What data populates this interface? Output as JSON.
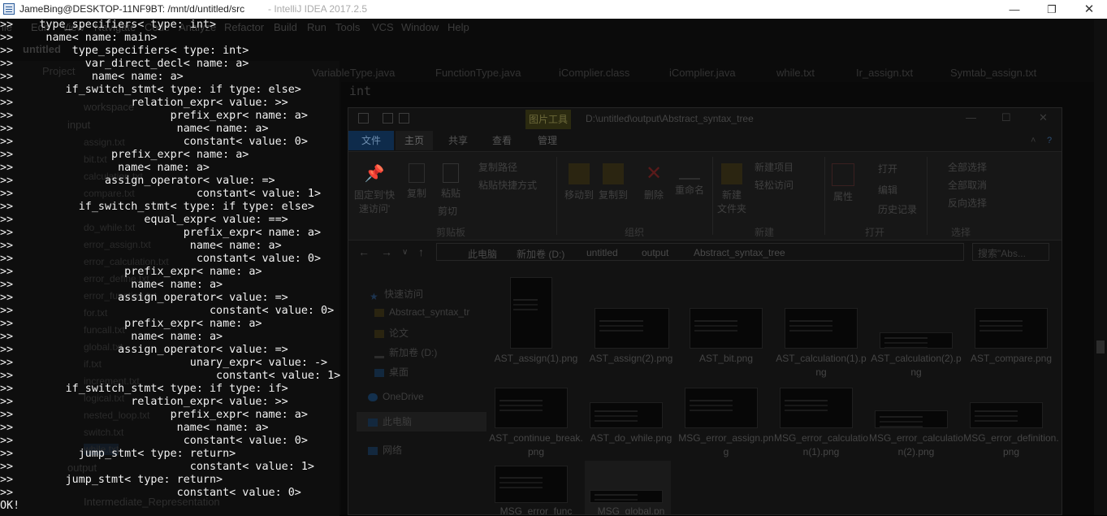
{
  "window": {
    "title": "JameBing@DESKTOP-11NF9BT: /mnt/d/untitled/src",
    "ghost_title": "- IntelliJ IDEA 2017.2.5",
    "controls": {
      "minimize": "—",
      "restore": "❐",
      "close": "✕"
    }
  },
  "ide": {
    "menus": [
      "ile",
      "Edit",
      "View",
      "Navigate",
      "Code",
      "Analyze",
      "Refactor",
      "Build",
      "Run",
      "Tools",
      "VCS",
      "Window",
      "Help"
    ],
    "project_title": "untitled",
    "project_label": "Project",
    "tabs": [
      "VariableType.java",
      "FunctionType.java",
      "iComplier.class",
      "iComplier.java",
      "while.txt",
      "Ir_assign.txt",
      "Symtab_assign.txt"
    ],
    "tree_folders": [
      "workspace",
      "input",
      "output",
      "Intermediate_Representation"
    ],
    "tree_files": [
      "assign.txt",
      "bit.txt",
      "calculation.txt",
      "compare.txt",
      "do_while.txt",
      "error_assign.txt",
      "error_calculation.txt",
      "error_define.txt",
      "error_function.txt",
      "for.txt",
      "funcall.txt",
      "global.txt",
      "if.txt",
      "increment.txt",
      "logical.txt",
      "nested_loop.txt",
      "switch.txt",
      "while.txt"
    ],
    "editor_first_line": "int"
  },
  "explorer": {
    "path_title": "D:\\untitled\\output\\Abstract_syntax_tree",
    "picture_tools": "图片工具",
    "tabs": [
      "文件",
      "主页",
      "共享",
      "查看",
      "管理"
    ],
    "ribbon": {
      "pin": "固定到'快\n速访问'",
      "copy": "复制",
      "paste": "粘贴",
      "copy_path": "复制路径",
      "paste_shortcut": "粘贴快捷方式",
      "cut": "剪切",
      "move_to": "移动到",
      "copy_to": "复制到",
      "delete": "删除",
      "rename": "重命名",
      "new_folder": "新建\n文件夹",
      "new_item": "新建项目",
      "easy_access": "轻松访问",
      "properties": "属性",
      "open": "打开",
      "edit": "编辑",
      "history": "历史记录",
      "select_all": "全部选择",
      "select_none": "全部取消",
      "invert_selection": "反向选择",
      "groups": {
        "clipboard": "剪贴板",
        "organize": "组织",
        "new": "新建",
        "open": "打开",
        "select": "选择"
      }
    },
    "address": [
      "此电脑",
      "新加卷 (D:)",
      "untitled",
      "output",
      "Abstract_syntax_tree"
    ],
    "search_placeholder": "搜索\"Abs...",
    "nav": {
      "quick_access": "快速访问",
      "ast_folder": "Abstract_syntax_tr",
      "paper": "论文",
      "drive": "新加卷 (D:)",
      "desktop": "桌面",
      "onedrive": "OneDrive",
      "this_pc": "此电脑",
      "network": "网络"
    },
    "files": [
      "AST_assign(1).png",
      "AST_assign(2).png",
      "AST_bit.png",
      "AST_calculation(1).png",
      "AST_calculation(2).png",
      "AST_compare.png",
      "AST_continue_break.png",
      "AST_do_while.png",
      "MSG_error_assign.png",
      "MSG_error_calculation(1).png",
      "MSG_error_calculation(2).png",
      "MSG_error_definition.png",
      "MSG_error_func",
      "MSG_global.pn"
    ]
  },
  "terminal": {
    "lines": [
      ">>    type_specifiers< type: int>",
      ">>     name< name: main>",
      ">>         type_specifiers< type: int>",
      ">>           var_direct_decl< name: a>",
      ">>            name< name: a>",
      ">>        if_switch_stmt< type: if type: else>",
      ">>                  relation_expr< value: >>",
      ">>                        prefix_expr< name: a>",
      ">>                         name< name: a>",
      ">>                          constant< value: 0>",
      ">>               prefix_expr< name: a>",
      ">>                name< name: a>",
      ">>              assign_operator< value: =>",
      ">>                            constant< value: 1>",
      ">>          if_switch_stmt< type: if type: else>",
      ">>                    equal_expr< value: ==>",
      ">>                          prefix_expr< name: a>",
      ">>                           name< name: a>",
      ">>                            constant< value: 0>",
      ">>                 prefix_expr< name: a>",
      ">>                  name< name: a>",
      ">>                assign_operator< value: =>",
      ">>                              constant< value: 0>",
      ">>                 prefix_expr< name: a>",
      ">>                  name< name: a>",
      ">>                assign_operator< value: =>",
      ">>                           unary_expr< value: ->",
      ">>                               constant< value: 1>",
      ">>        if_switch_stmt< type: if type: if>",
      ">>                  relation_expr< value: >>",
      ">>                        prefix_expr< name: a>",
      ">>                         name< name: a>",
      ">>                          constant< value: 0>",
      ">>          jump_stmt< type: return>",
      ">>                           constant< value: 1>",
      ">>        jump_stmt< type: return>",
      ">>                         constant< value: 0>",
      "OK!"
    ]
  }
}
